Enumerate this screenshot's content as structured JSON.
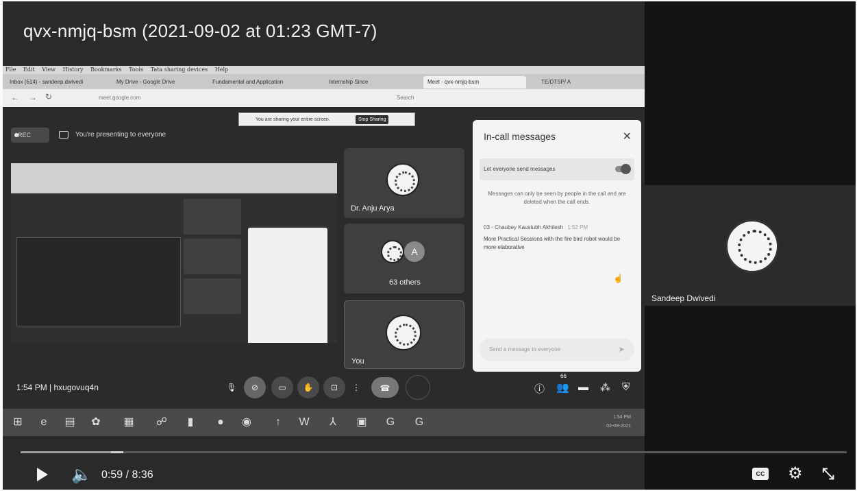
{
  "video": {
    "title": "qvx-nmjq-bsm (2021-09-02 at 01:23 GMT-7)"
  },
  "browser": {
    "menu": [
      "File",
      "Edit",
      "View",
      "History",
      "Bookmarks",
      "Tools",
      "Tata sharing devices",
      "Help"
    ],
    "tabs": [
      {
        "label": "Inbox (614) - sandeep.dwivedi"
      },
      {
        "label": "My Drive - Google Drive"
      },
      {
        "label": "Fundamental and Application"
      },
      {
        "label": "Internship Since"
      },
      {
        "label": "Meet - qvx-nmjq-bsm"
      },
      {
        "label": "TE/DTSP/ A"
      }
    ],
    "url_host": "meet.google.com",
    "search_placeholder": "Search"
  },
  "meet": {
    "rec_label": "REC",
    "presenting_label": "You're presenting to everyone",
    "share_bar": {
      "text": "You are sharing your entire screen.",
      "stop_label": "Stop Sharing"
    },
    "tiles": {
      "anju": "Dr. Anju Arya",
      "others": "63 others",
      "avatar_letter": "A",
      "you": "You"
    },
    "chat": {
      "title": "In-call messages",
      "toggle_label": "Let everyone send messages",
      "info": "Messages can only be seen by people in the call and are deleted when the call ends.",
      "sender": "03 - Chaubey Kaustubh Akhilesh",
      "sender_time": "1:52 PM",
      "message": "More Practical Sessions with the fire bird robot would be more elaborative",
      "input_placeholder": "Send a message to everyone"
    },
    "bottom": {
      "time_code": "1:54 PM  |  hxugovuq4n",
      "participant_count": "66"
    },
    "tray": {
      "time": "1:54 PM",
      "date": "02-09-2021"
    }
  },
  "side": {
    "presenter_name": "Sandeep Dwivedi"
  },
  "player": {
    "time": "0:59 / 8:36",
    "cc_label": "CC",
    "progress": 0.117
  }
}
